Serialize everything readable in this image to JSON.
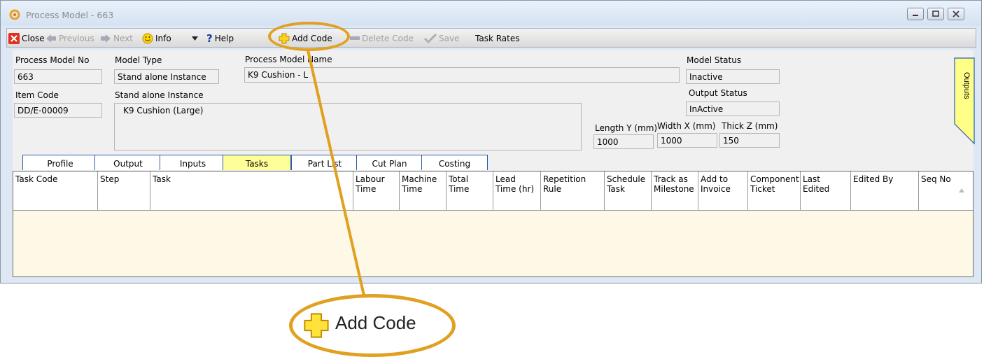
{
  "window": {
    "title": "Process Model - 663"
  },
  "toolbar": {
    "close": "Close",
    "previous": "Previous",
    "next": "Next",
    "info": "Info",
    "help": "Help",
    "add_code": "Add Code",
    "delete_code": "Delete Code",
    "save": "Save",
    "task_rates": "Task Rates"
  },
  "form": {
    "process_model_no_label": "Process Model No",
    "process_model_no": "663",
    "model_type_label": "Model Type",
    "model_type": "Stand alone Instance",
    "process_model_name_label": "Process Model Name",
    "process_model_name": "K9 Cushion - L",
    "model_status_label": "Model Status",
    "model_status": "Inactive",
    "item_code_label": "Item Code",
    "item_code": "DD/E-00009",
    "stand_alone_label": "Stand alone Instance",
    "stand_alone_value": "K9 Cushion (Large)",
    "output_status_label": "Output Status",
    "output_status": "InActive",
    "length_label": "Length Y (mm)",
    "length": "1000",
    "width_label": "Width X (mm)",
    "width": "1000",
    "thick_label": "Thick Z (mm)",
    "thick": "150",
    "outputs_tab": "Outputs"
  },
  "tabs": [
    "Profile",
    "Output",
    "Inputs",
    "Tasks",
    "Part List",
    "Cut Plan",
    "Costing"
  ],
  "active_tab": "Tasks",
  "grid": {
    "columns": [
      {
        "l1": "Task Code",
        "l2": ""
      },
      {
        "l1": "Step",
        "l2": ""
      },
      {
        "l1": "Task",
        "l2": ""
      },
      {
        "l1": "Labour",
        "l2": "Time"
      },
      {
        "l1": "Machine",
        "l2": "Time"
      },
      {
        "l1": "Total",
        "l2": "Time"
      },
      {
        "l1": "Lead",
        "l2": "Time (hr)"
      },
      {
        "l1": "Repetition",
        "l2": "Rule"
      },
      {
        "l1": "Schedule",
        "l2": "Task"
      },
      {
        "l1": "Track as",
        "l2": "Milestone"
      },
      {
        "l1": "Add to",
        "l2": "Invoice"
      },
      {
        "l1": "Component",
        "l2": "Ticket"
      },
      {
        "l1": "Last Edited",
        "l2": ""
      },
      {
        "l1": "Edited By",
        "l2": ""
      },
      {
        "l1": "Seq No",
        "l2": ""
      }
    ]
  },
  "callout": {
    "label": "Add Code"
  },
  "colors": {
    "accent": "#e0a020",
    "active_tab": "#ffff99",
    "grid_body": "#fdf9e6"
  }
}
